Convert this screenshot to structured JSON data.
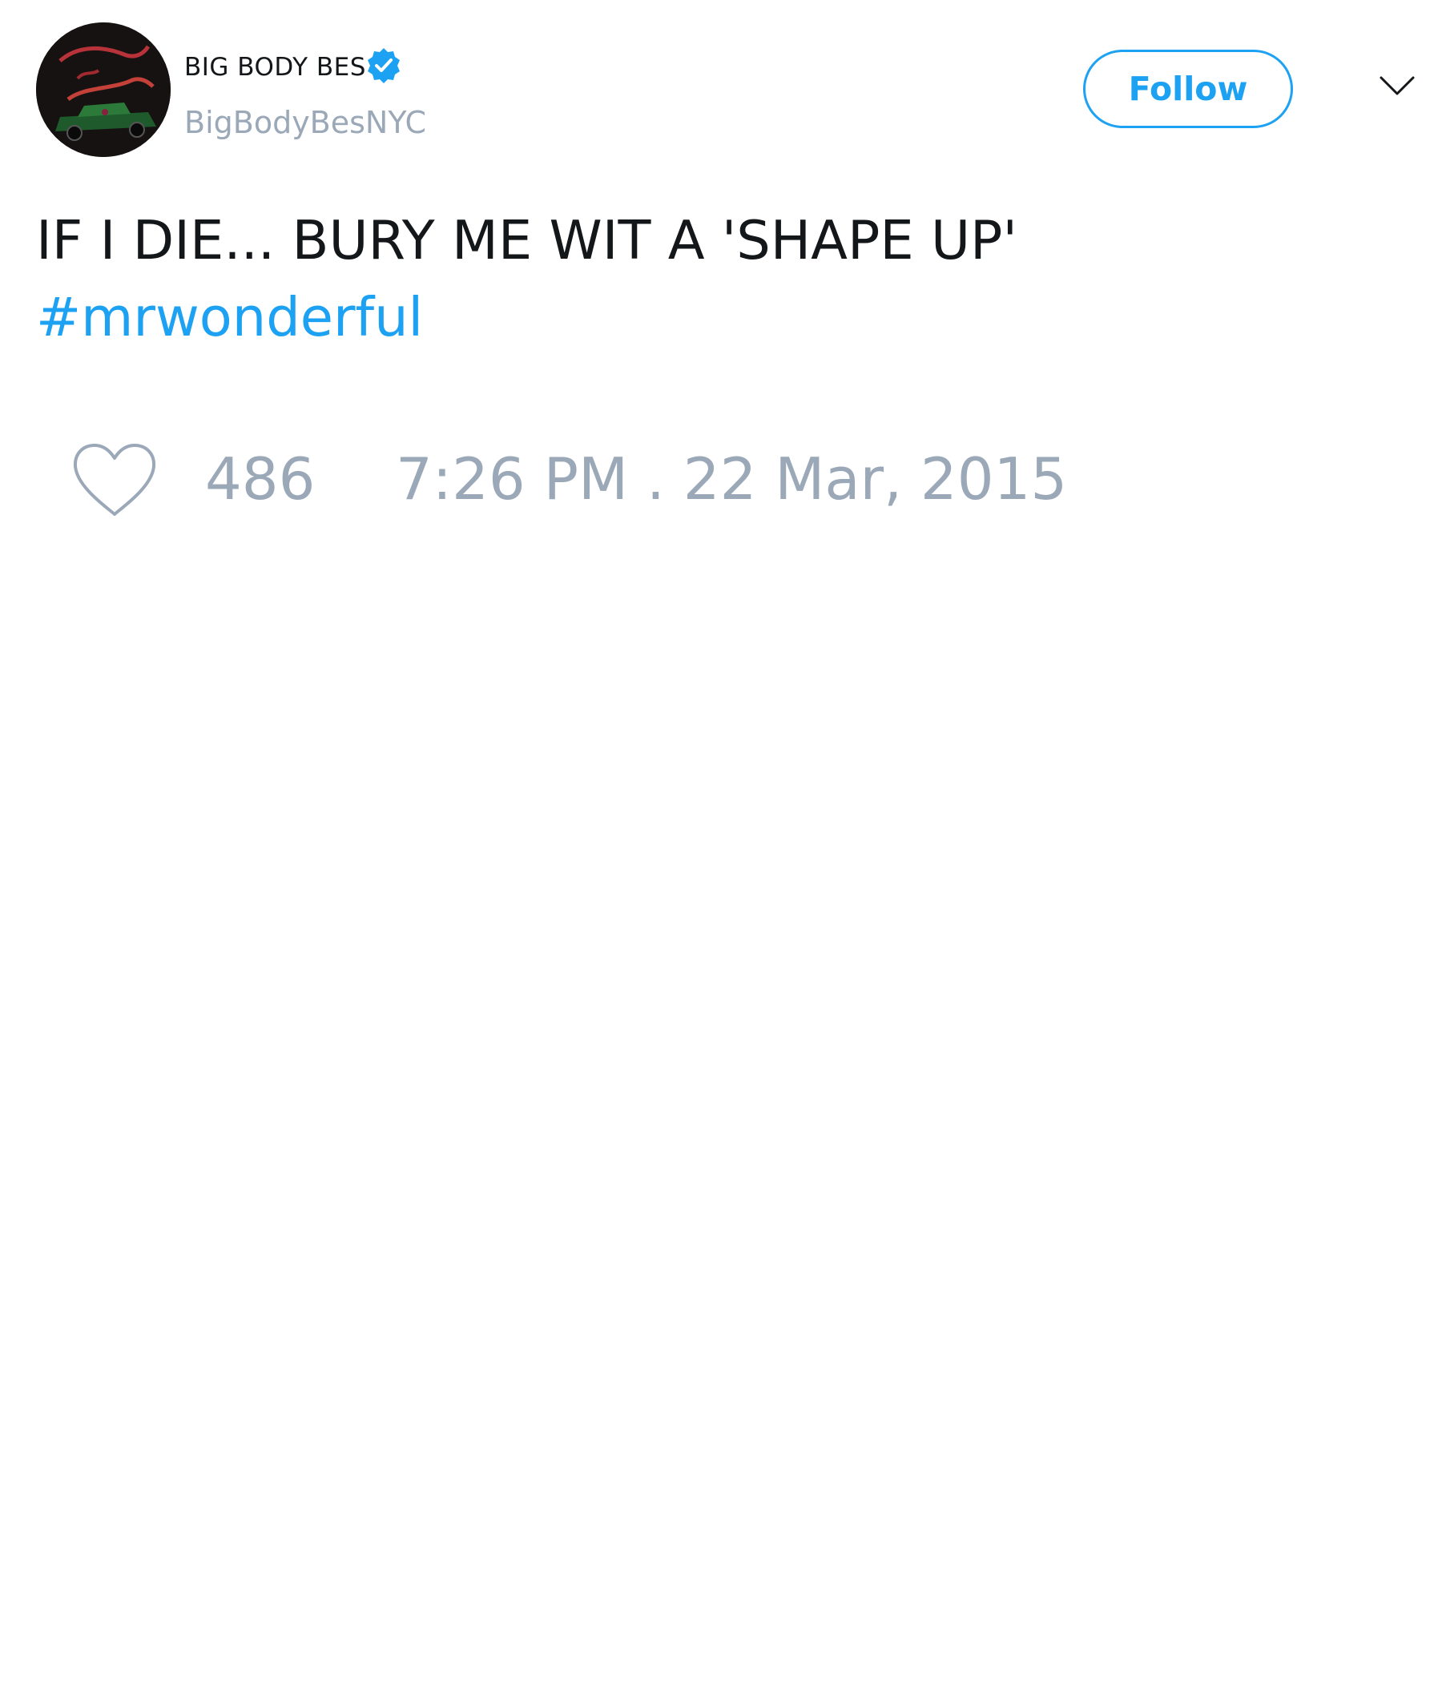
{
  "author": {
    "display_name": "BIG BODY BES",
    "handle": "BigBodyBesNYC",
    "verified": true,
    "avatar_icon": "profile-avatar"
  },
  "actions": {
    "follow_label": "Follow",
    "menu_icon": "chevron-down-icon"
  },
  "tweet": {
    "text": "IF I DIE... BURY ME WIT A 'SHAPE UP'",
    "hashtag": "#mrwonderful"
  },
  "stats": {
    "like_icon": "heart-icon",
    "likes": "486",
    "timestamp": "7:26 PM . 22 Mar, 2015"
  },
  "colors": {
    "accent": "#1da1f2",
    "text": "#14171a",
    "muted": "#9aa8b8",
    "background": "#ffffff"
  }
}
